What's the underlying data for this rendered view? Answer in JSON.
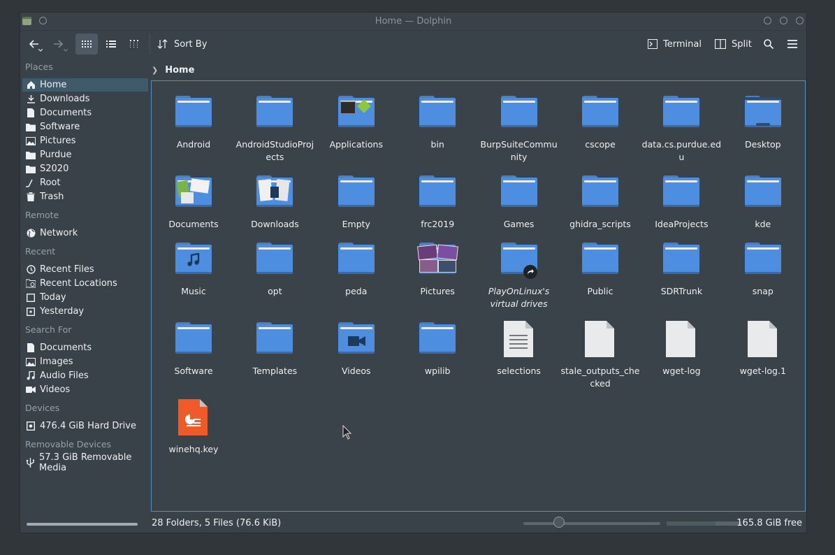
{
  "window": {
    "title": "Home — Dolphin"
  },
  "toolbar": {
    "sort_label": "Sort By",
    "terminal_label": "Terminal",
    "split_label": "Split"
  },
  "breadcrumb": {
    "current": "Home"
  },
  "sidebar": {
    "places_title": "Places",
    "places": [
      "Home",
      "Downloads",
      "Documents",
      "Software",
      "Pictures",
      "Purdue",
      "S2020",
      "Root",
      "Trash"
    ],
    "remote_title": "Remote",
    "remote": [
      "Network"
    ],
    "recent_title": "Recent",
    "recent": [
      "Recent Files",
      "Recent Locations",
      "Today",
      "Yesterday"
    ],
    "search_title": "Search For",
    "search": [
      "Documents",
      "Images",
      "Audio Files",
      "Videos"
    ],
    "devices_title": "Devices",
    "devices": [
      "476.4 GiB Hard Drive"
    ],
    "removable_title": "Removable Devices",
    "removable": [
      "57.3 GiB Removable Media"
    ]
  },
  "items": [
    {
      "name": "Android",
      "type": "folder"
    },
    {
      "name": "AndroidStudioProjects",
      "type": "folder"
    },
    {
      "name": "Applications",
      "type": "folder-apps"
    },
    {
      "name": "bin",
      "type": "folder"
    },
    {
      "name": "BurpSuiteCommunity",
      "type": "folder"
    },
    {
      "name": "cscope",
      "type": "folder"
    },
    {
      "name": "data.cs.purdue.edu",
      "type": "folder"
    },
    {
      "name": "Desktop",
      "type": "folder-desktop"
    },
    {
      "name": "Documents",
      "type": "folder-docs"
    },
    {
      "name": "Downloads",
      "type": "folder-downloads"
    },
    {
      "name": "Empty",
      "type": "folder"
    },
    {
      "name": "frc2019",
      "type": "folder"
    },
    {
      "name": "Games",
      "type": "folder"
    },
    {
      "name": "ghidra_scripts",
      "type": "folder"
    },
    {
      "name": "IdeaProjects",
      "type": "folder"
    },
    {
      "name": "kde",
      "type": "folder"
    },
    {
      "name": "Music",
      "type": "folder-music"
    },
    {
      "name": "opt",
      "type": "folder"
    },
    {
      "name": "peda",
      "type": "folder"
    },
    {
      "name": "Pictures",
      "type": "folder-pictures"
    },
    {
      "name": "PlayOnLinux's virtual drives",
      "type": "folder-link"
    },
    {
      "name": "Public",
      "type": "folder"
    },
    {
      "name": "SDRTrunk",
      "type": "folder"
    },
    {
      "name": "snap",
      "type": "folder"
    },
    {
      "name": "Software",
      "type": "folder"
    },
    {
      "name": "Templates",
      "type": "folder"
    },
    {
      "name": "Videos",
      "type": "folder-videos"
    },
    {
      "name": "wpilib",
      "type": "folder"
    },
    {
      "name": "selections",
      "type": "text-file"
    },
    {
      "name": "stale_outputs_checked",
      "type": "file"
    },
    {
      "name": "wget-log",
      "type": "file"
    },
    {
      "name": "wget-log.1",
      "type": "file"
    },
    {
      "name": "winehq.key",
      "type": "key-file"
    }
  ],
  "status": {
    "summary": "28 Folders, 5 Files (76.6 KiB)",
    "free_space": "165.8 GiB free"
  },
  "colors": {
    "accent": "#4c92c6",
    "folder": "#4d8ee0",
    "selection": "#3e5a6b",
    "key_file": "#f05a28"
  }
}
